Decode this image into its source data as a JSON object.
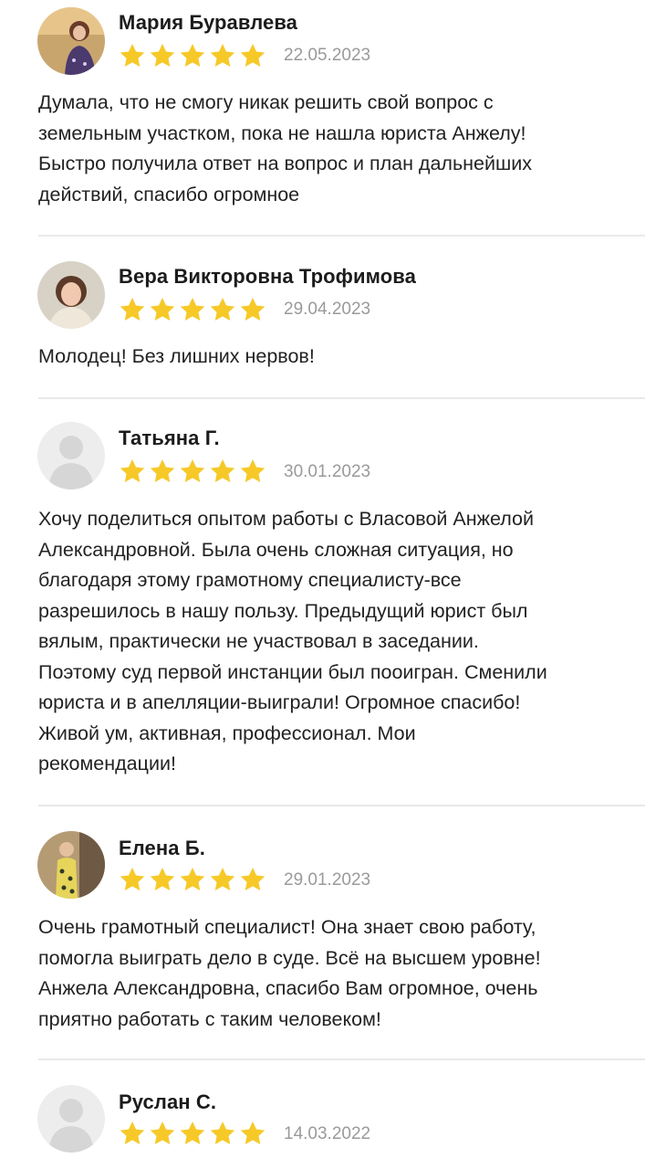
{
  "reviews": [
    {
      "name": "Мария Буравлева",
      "date": "22.05.2023",
      "rating": 5,
      "avatar": "photo",
      "lines": [
        "Думала, что не смогу никак решить свой вопрос с",
        "земельным участком, пока не нашла юриста Анжелу!",
        "Быстро получила ответ на вопрос и план дальнейших",
        "действий, спасибо огромное"
      ]
    },
    {
      "name": "Вера Викторовна Трофимова",
      "date": "29.04.2023",
      "rating": 5,
      "avatar": "photo",
      "lines": [
        "Молодец! Без лишних нервов!"
      ]
    },
    {
      "name": "Татьяна Г.",
      "date": "30.01.2023",
      "rating": 5,
      "avatar": "placeholder",
      "lines": [
        "Хочу поделиться опытом работы с Власовой Анжелой",
        "Александровной. Была очень сложная ситуация, но",
        "благодаря этому грамотному специалисту-все",
        "разрешилось в нашу пользу. Предыдущий юрист был",
        "вялым, практически не участвовал в заседании.",
        "Поэтому суд первой инстанции был пооигран. Сменили",
        "юриста и в апелляции-выиграли! Огромное спасибо!",
        "Живой ум, активная, профессионал. Мои",
        "рекомендации!"
      ]
    },
    {
      "name": "Елена Б.",
      "date": "29.01.2023",
      "rating": 5,
      "avatar": "photo",
      "lines": [
        "Очень грамотный специалист! Она знает свою работу,",
        "помогла выиграть дело в суде. Всё на высшем уровне!",
        "Анжела Александровна, спасибо Вам огромное, очень",
        "приятно работать с таким человеком!"
      ]
    },
    {
      "name": "Руслан С.",
      "date": "14.03.2022",
      "rating": 5,
      "avatar": "placeholder",
      "lines": []
    }
  ],
  "colors": {
    "star": "#f6c928",
    "date": "#9a9a9a",
    "divider": "#e9e9e9"
  },
  "icons": {
    "star": "star-icon",
    "placeholder_avatar": "user-silhouette-icon"
  }
}
